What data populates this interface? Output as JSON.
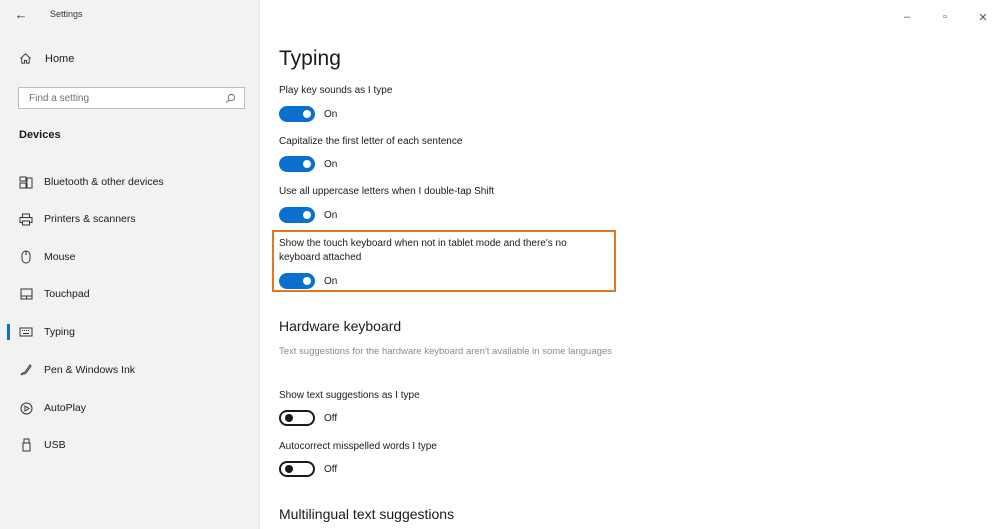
{
  "window": {
    "title": "Settings",
    "controls": {
      "minimize": "–",
      "maximize": "▫",
      "close": "✕"
    }
  },
  "sidebar": {
    "home_label": "Home",
    "search_placeholder": "Find a setting",
    "section_label": "Devices",
    "items": [
      {
        "label": "Bluetooth & other devices",
        "icon": "bluetooth-devices-icon"
      },
      {
        "label": "Printers & scanners",
        "icon": "printer-icon"
      },
      {
        "label": "Mouse",
        "icon": "mouse-icon"
      },
      {
        "label": "Touchpad",
        "icon": "touchpad-icon"
      },
      {
        "label": "Typing",
        "icon": "keyboard-icon",
        "selected": true
      },
      {
        "label": "Pen & Windows Ink",
        "icon": "pen-icon"
      },
      {
        "label": "AutoPlay",
        "icon": "autoplay-icon"
      },
      {
        "label": "USB",
        "icon": "usb-icon"
      }
    ]
  },
  "main": {
    "title": "Typing",
    "settings": [
      {
        "label": "Play key sounds as I type",
        "state": "On"
      },
      {
        "label": "Capitalize the first letter of each sentence",
        "state": "On"
      },
      {
        "label": "Use all uppercase letters when I double-tap Shift",
        "state": "On"
      },
      {
        "label": "Show the touch keyboard when not in tablet mode and there's no keyboard attached",
        "state": "On",
        "highlighted": true
      }
    ],
    "hardware": {
      "heading": "Hardware keyboard",
      "description": "Text suggestions for the hardware keyboard aren't available in some languages",
      "settings": [
        {
          "label": "Show text suggestions as I type",
          "state": "Off"
        },
        {
          "label": "Autocorrect misspelled words I type",
          "state": "Off"
        }
      ]
    },
    "multilingual_heading": "Multilingual text suggestions"
  },
  "colors": {
    "accent": "#0b6fd0",
    "highlight": "#e07a22",
    "sidebar_bg": "#f2f2f2"
  }
}
